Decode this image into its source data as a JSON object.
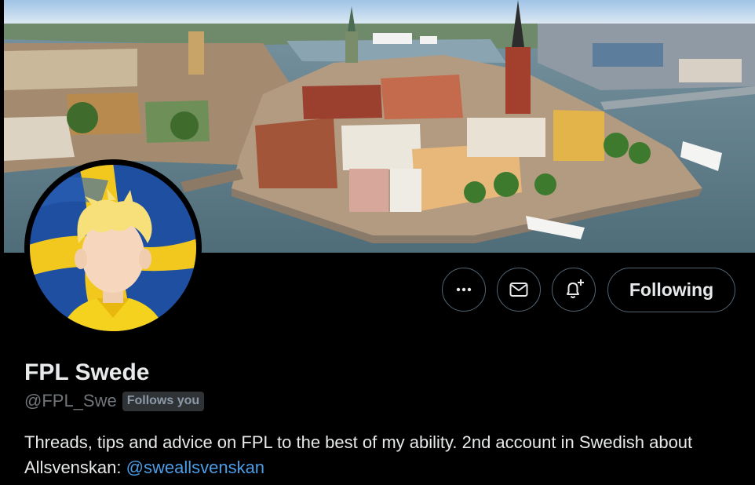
{
  "profile": {
    "display_name": "FPL Swede",
    "handle": "@FPL_Swe",
    "follows_you_badge": "Follows you",
    "bio_text": "Threads, tips and advice on FPL to the best of my ability. 2nd account in Swedish about Allsvenskan: ",
    "bio_mention": "@sweallsvenskan"
  },
  "actions": {
    "more_icon": "ellipsis-icon",
    "message_icon": "envelope-icon",
    "notify_icon": "bell-plus-icon",
    "following_label": "Following"
  },
  "colors": {
    "background": "#000000",
    "text_primary": "#e7e9ea",
    "text_secondary": "#71767b",
    "link": "#4a9ee8",
    "button_border": "#536471",
    "badge_bg": "#2f3336"
  }
}
